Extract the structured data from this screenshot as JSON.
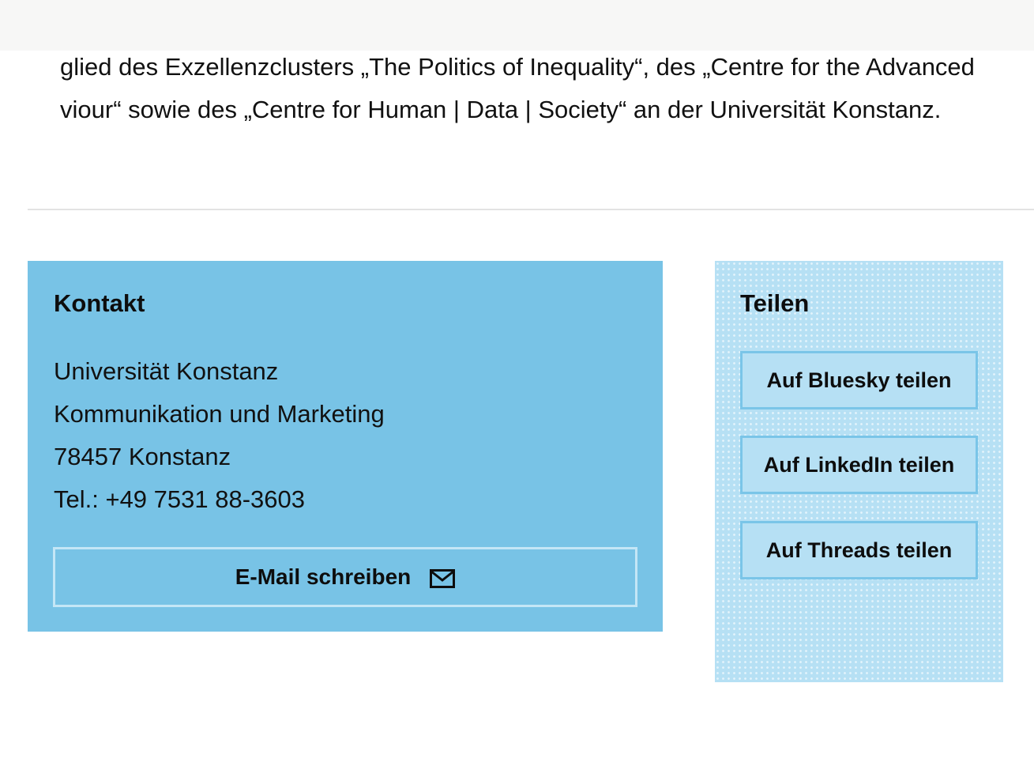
{
  "article": {
    "text_lines": [
      "glied des Exzellenzclusters „The Politics of Inequality“, des „Centre for the Advanced",
      "viour“ sowie des „Centre for Human | Data | Society“ an der Universität Konstanz."
    ]
  },
  "contact": {
    "heading": "Kontakt",
    "address_lines": [
      "Universität Konstanz",
      "Kommunikation und Marketing",
      "78457 Konstanz",
      "Tel.: +49 7531 88-3603"
    ],
    "email_button_label": "E-Mail schreiben",
    "email_icon": "envelope-icon",
    "background_color": "#78c3e6"
  },
  "share": {
    "heading": "Teilen",
    "buttons": [
      {
        "label": "Auf Bluesky teilen"
      },
      {
        "label": "Auf LinkedIn teilen"
      },
      {
        "label": "Auf Threads teilen"
      }
    ],
    "background_color": "#b6e0f4"
  }
}
